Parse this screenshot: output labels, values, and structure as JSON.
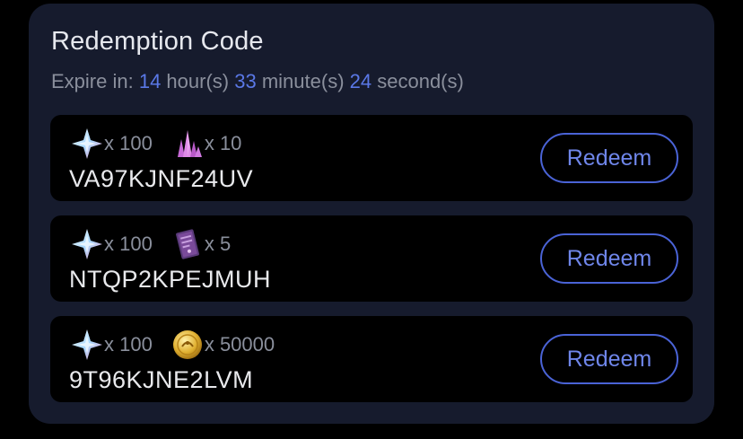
{
  "panel": {
    "title": "Redemption Code",
    "expire": {
      "prefix": "Expire in: ",
      "hours": "14",
      "hours_unit": " hour(s) ",
      "minutes": "33",
      "minutes_unit": " minute(s) ",
      "seconds": "24",
      "seconds_unit": " second(s)"
    }
  },
  "codes": [
    {
      "code": "VA97KJNF24UV",
      "redeem_label": "Redeem",
      "rewards": [
        {
          "icon": "primogem-icon",
          "qty": "x 100"
        },
        {
          "icon": "crystal-icon",
          "qty": "x 10"
        }
      ]
    },
    {
      "code": "NTQP2KPEJMUH",
      "redeem_label": "Redeem",
      "rewards": [
        {
          "icon": "primogem-icon",
          "qty": "x 100"
        },
        {
          "icon": "book-icon",
          "qty": "x 5"
        }
      ]
    },
    {
      "code": "9T96KJNE2LVM",
      "redeem_label": "Redeem",
      "rewards": [
        {
          "icon": "primogem-icon",
          "qty": "x 100"
        },
        {
          "icon": "mora-coin-icon",
          "qty": "x 50000"
        }
      ]
    }
  ],
  "colors": {
    "background": "#000000",
    "card": "#161b2d",
    "accent": "#5a78e6",
    "button_border": "#4a63d6",
    "muted_text": "#8a8f9c"
  }
}
